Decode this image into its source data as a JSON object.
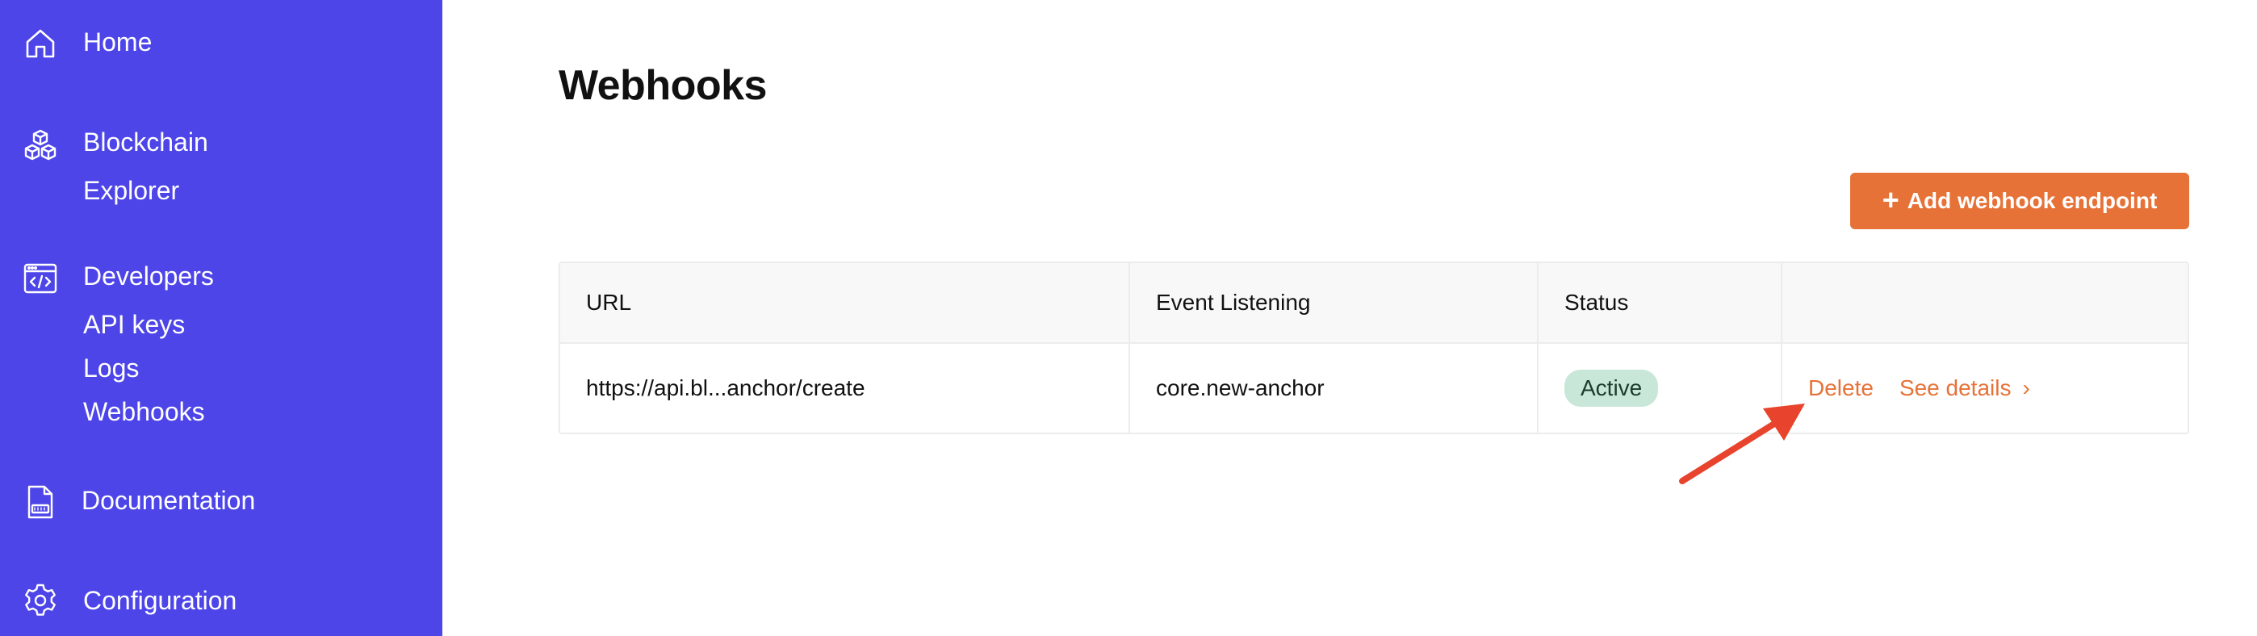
{
  "sidebar": {
    "items": [
      {
        "label": "Home",
        "icon": "home-icon"
      },
      {
        "label": "Blockchain",
        "icon": "cubes-icon"
      },
      {
        "label": "Explorer"
      },
      {
        "label": "Developers",
        "icon": "code-window-icon"
      },
      {
        "label": "API keys"
      },
      {
        "label": "Logs"
      },
      {
        "label": "Webhooks"
      },
      {
        "label": "Documentation",
        "icon": "doc-file-icon"
      },
      {
        "label": "Configuration",
        "icon": "gear-icon"
      }
    ],
    "background": "#4d45e8"
  },
  "main": {
    "title": "Webhooks",
    "add_button_label": "Add webhook endpoint",
    "table": {
      "headers": [
        "URL",
        "Event Listening",
        "Status",
        ""
      ],
      "rows": [
        {
          "url": "https://api.bl...anchor/create",
          "event": "core.new-anchor",
          "status": "Active",
          "delete_label": "Delete",
          "details_label": "See details"
        }
      ]
    }
  },
  "colors": {
    "accent": "#e67238",
    "status_active_bg": "#c9e7d8",
    "annotation_arrow": "#e8432c"
  }
}
